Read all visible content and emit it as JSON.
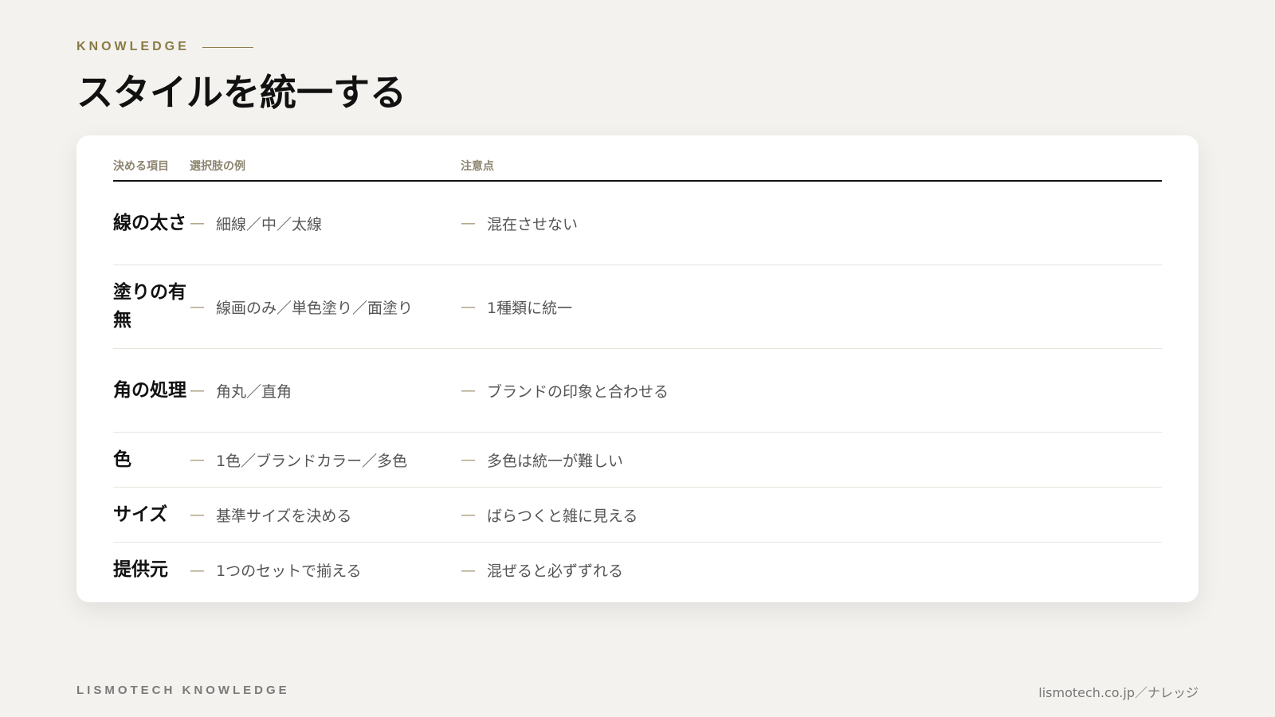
{
  "eyebrow": "KNOWLEDGE",
  "title": "スタイルを統一する",
  "table": {
    "headers": [
      "決める項目",
      "選択肢の例",
      "注意点"
    ],
    "dash": "—",
    "rows": [
      {
        "item": "線の太さ",
        "options": "細線／中／太線",
        "note": "混在させない"
      },
      {
        "item": "塗りの有無",
        "options": "線画のみ／単色塗り／面塗り",
        "note": "1種類に統一"
      },
      {
        "item": "角の処理",
        "options": "角丸／直角",
        "note": "ブランドの印象と合わせる"
      },
      {
        "item": "色",
        "options": "1色／ブランドカラー／多色",
        "note": "多色は統一が難しい"
      },
      {
        "item": "サイズ",
        "options": "基準サイズを決める",
        "note": "ばらつくと雑に見える"
      },
      {
        "item": "提供元",
        "options": "1つのセットで揃える",
        "note": "混ぜると必ずずれる"
      }
    ]
  },
  "footer": {
    "brand": "LISMOTECH KNOWLEDGE",
    "url": "lismotech.co.jp／ナレッジ"
  },
  "colors": {
    "accent": "#8a7a45",
    "background": "#f3f2ef",
    "card": "#ffffff"
  }
}
